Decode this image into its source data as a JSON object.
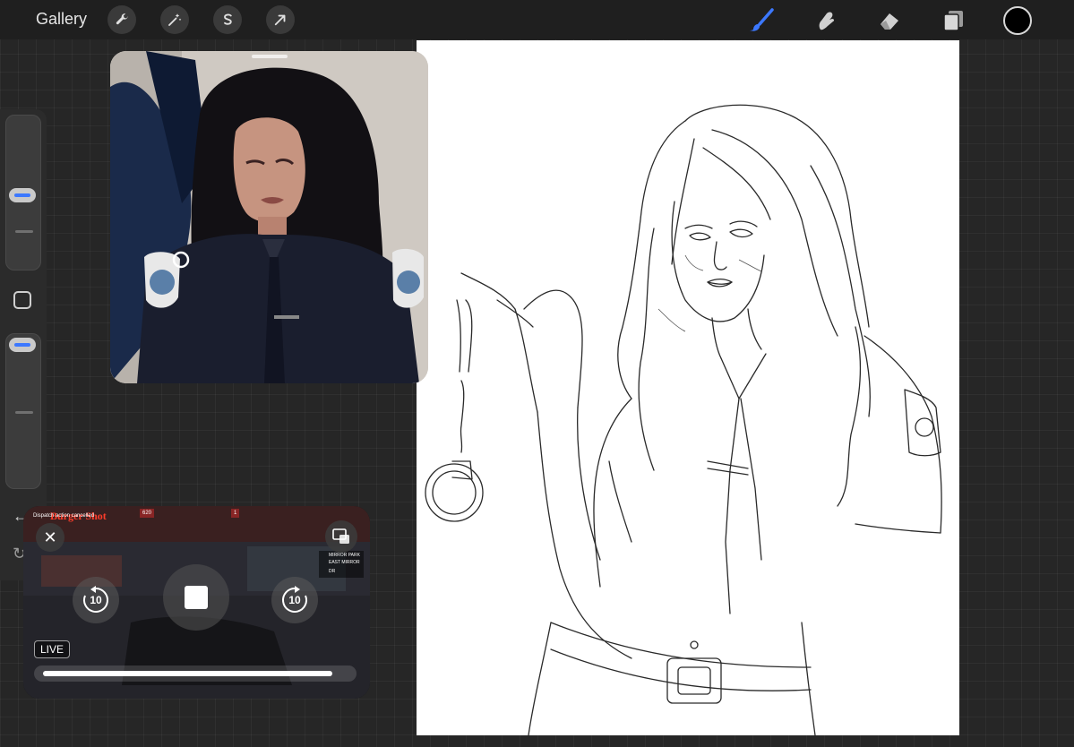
{
  "toolbar": {
    "gallery_label": "Gallery",
    "left_tools": [
      "wrench-icon",
      "magic-wand-icon",
      "selection-s-icon",
      "transform-arrow-icon"
    ],
    "right_tools": [
      "brush-icon",
      "smudge-icon",
      "eraser-icon",
      "layers-icon"
    ],
    "active_tool": "brush-icon",
    "active_color": "#3c78ff",
    "current_color": "#000000"
  },
  "sidebar": {
    "brush_size_level": 0.48,
    "opacity_level": 0.08
  },
  "player": {
    "hud_title": "Burger Shot",
    "hud_notice": "Dispatch action cancelled",
    "hud_stats": [
      "620",
      "1",
      "",
      ""
    ],
    "location_lines": [
      "MIRROR PARK",
      "EAST MIRROR DR"
    ],
    "skip_back_label": "10",
    "skip_forward_label": "10",
    "live_label": "LIVE",
    "progress": 0.95
  }
}
